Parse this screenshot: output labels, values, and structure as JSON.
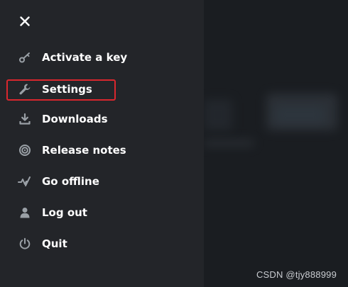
{
  "menu": {
    "items": [
      {
        "id": "activate",
        "label": "Activate a key",
        "icon": "key-icon"
      },
      {
        "id": "settings",
        "label": "Settings",
        "icon": "wrench-icon"
      },
      {
        "id": "downloads",
        "label": "Downloads",
        "icon": "download-icon"
      },
      {
        "id": "release",
        "label": "Release notes",
        "icon": "release-notes-icon"
      },
      {
        "id": "offline",
        "label": "Go offline",
        "icon": "offline-icon"
      },
      {
        "id": "logout",
        "label": "Log out",
        "icon": "user-icon"
      },
      {
        "id": "quit",
        "label": "Quit",
        "icon": "power-icon"
      }
    ]
  },
  "watermark": "CSDN @tjy888999",
  "colors": {
    "panel": "#232529",
    "text": "#ffffff",
    "icon": "#9aa0a6",
    "highlight": "#d9272e"
  }
}
